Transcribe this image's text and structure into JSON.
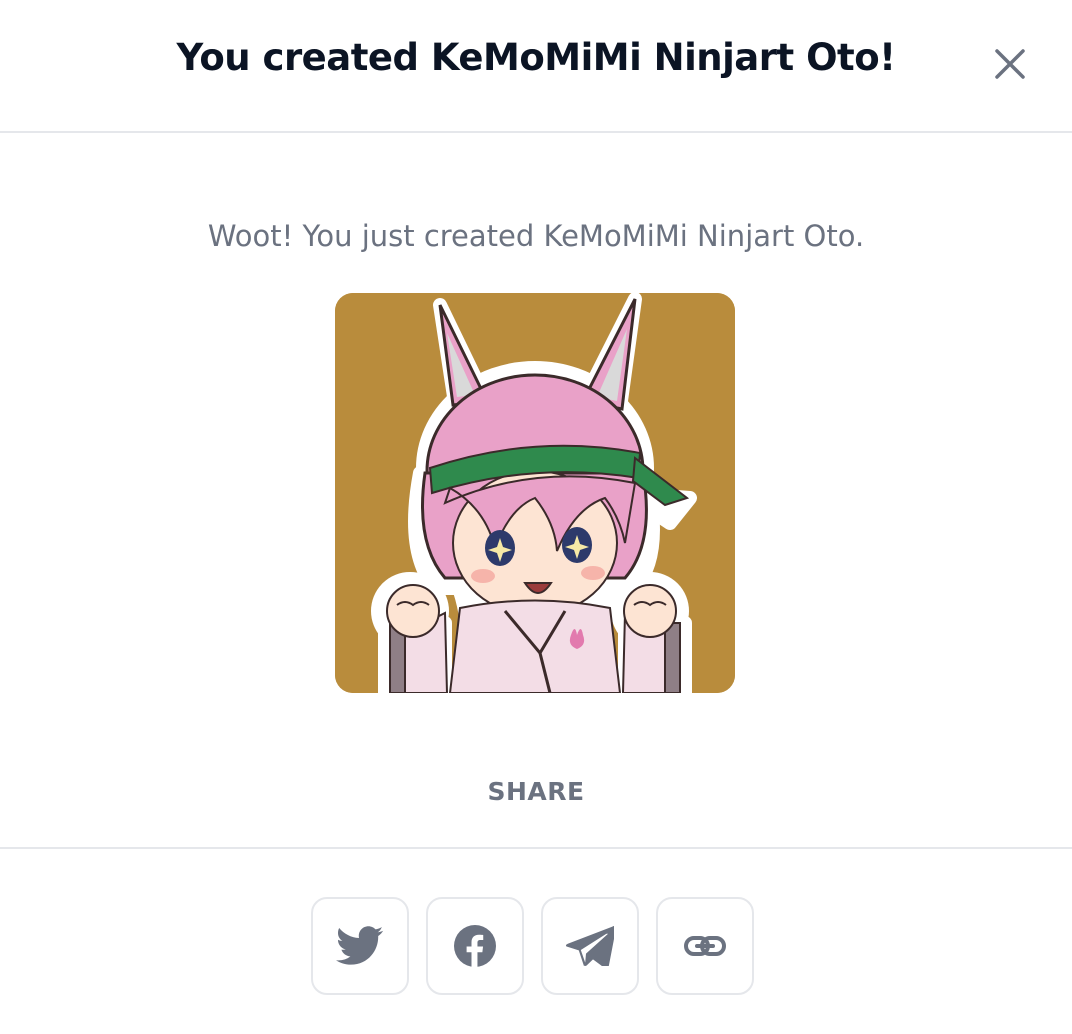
{
  "modal": {
    "title": "You created KeMoMiMi Ninjart Oto!",
    "close_icon": "close-icon",
    "message": "Woot! You just created KeMoMiMi Ninjart Oto.",
    "image": {
      "subject": "pink-haired bunny-eared ninja girl sticker",
      "background_color": "#b98c3c"
    },
    "share_label": "SHARE",
    "share_buttons": [
      {
        "icon": "twitter-icon"
      },
      {
        "icon": "facebook-icon"
      },
      {
        "icon": "telegram-icon"
      },
      {
        "icon": "link-icon"
      }
    ]
  },
  "colors": {
    "title": "#0b1424",
    "muted_text": "#6b7280",
    "icon": "#6b7280",
    "border": "#e5e7eb"
  }
}
